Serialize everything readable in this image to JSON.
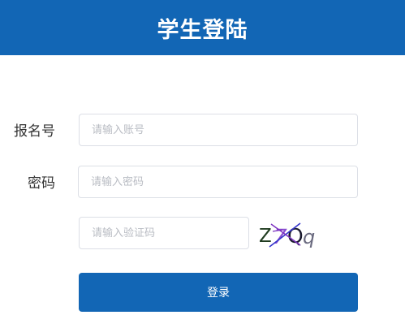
{
  "header": {
    "title": "学生登陆"
  },
  "form": {
    "registration_number": {
      "label": "报名号",
      "placeholder": "请输入账号",
      "value": ""
    },
    "password": {
      "label": "密码",
      "placeholder": "请输入密码",
      "value": ""
    },
    "captcha": {
      "placeholder": "请输入验证码",
      "value": "",
      "image_text": "Z 7 Q q"
    },
    "login_label": "登录"
  },
  "colors": {
    "brand": "#1266b5",
    "input_border": "#dcdfe6",
    "placeholder": "#b9bcc3",
    "label_text": "#333333",
    "captcha_chars": [
      "#1f3b1f",
      "#8a4fd0",
      "#1a1a2e",
      "#6b6b80"
    ],
    "captcha_noise": [
      "#3333cc",
      "#7a2fbf"
    ]
  }
}
